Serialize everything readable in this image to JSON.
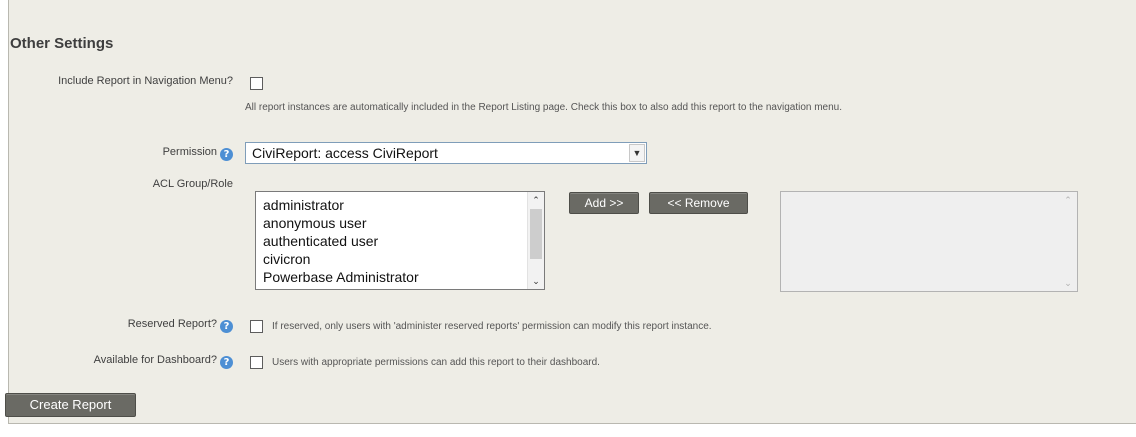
{
  "section": {
    "title": "Other Settings"
  },
  "navigation_menu": {
    "label": "Include Report in Navigation Menu?",
    "checked": false,
    "help_text": "All report instances are automatically included in the Report Listing page. Check this box to also add this report to the navigation menu."
  },
  "permission": {
    "label": "Permission",
    "help_icon": "question-circle-icon",
    "selected_value": "CiviReport: access CiviReport",
    "dropdown_icon": "chevron-down-icon"
  },
  "acl": {
    "label": "ACL Group/Role",
    "available_options": [
      "administrator",
      "anonymous user",
      "authenticated user",
      "civicron",
      "Powerbase Administrator"
    ],
    "add_button": "Add >>",
    "remove_button": "<< Remove",
    "selected_options": []
  },
  "reserved": {
    "label": "Reserved Report?",
    "checked": false,
    "help_text": "If reserved, only users with 'administer reserved reports' permission can modify this report instance."
  },
  "dashboard": {
    "label": "Available for Dashboard?",
    "checked": false,
    "help_text": "Users with appropriate permissions can add this report to their dashboard."
  },
  "actions": {
    "create_button": "Create Report"
  },
  "colors": {
    "panel_bg": "#eeede6",
    "button_bg": "#6a6a64",
    "help_icon": "#4d8fd4"
  }
}
